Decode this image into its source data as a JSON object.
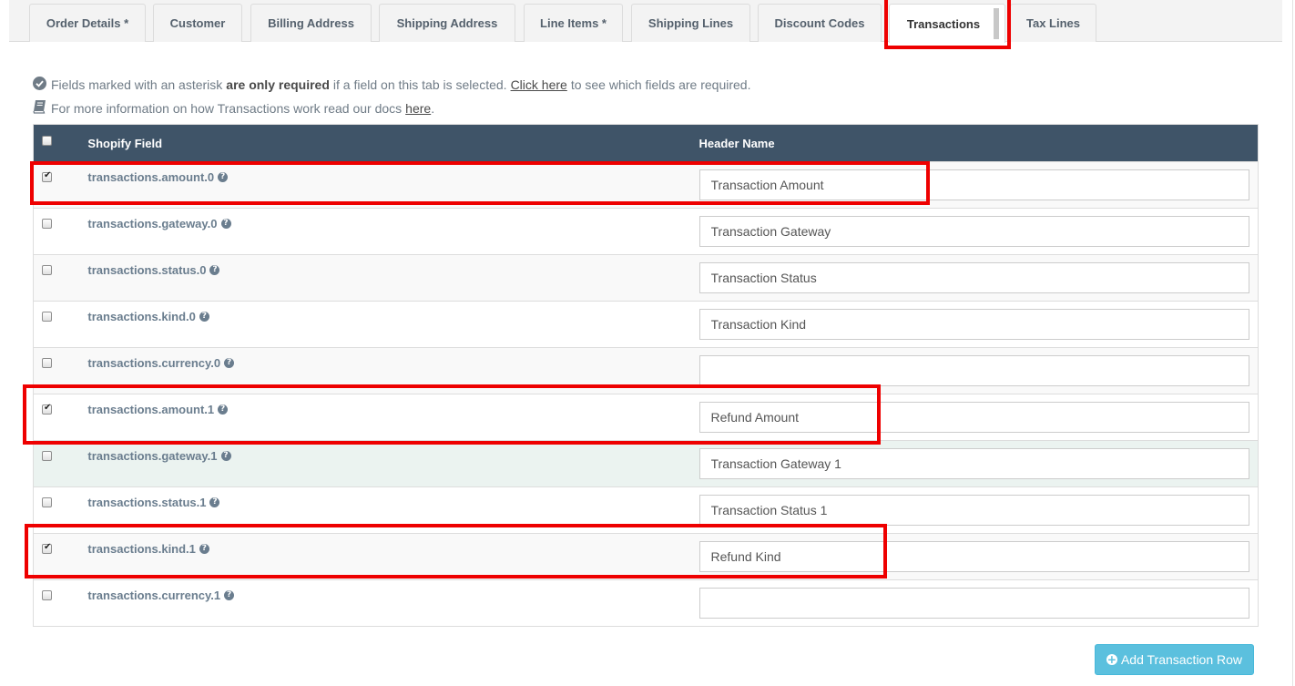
{
  "tabs": [
    {
      "label": "Order Details *"
    },
    {
      "label": "Customer"
    },
    {
      "label": "Billing Address"
    },
    {
      "label": "Shipping Address"
    },
    {
      "label": "Line Items *"
    },
    {
      "label": "Shipping Lines"
    },
    {
      "label": "Discount Codes"
    },
    {
      "label": "Transactions"
    },
    {
      "label": "Tax Lines"
    }
  ],
  "active_tab": "Transactions",
  "info": {
    "line1_pre": "Fields marked with an asterisk",
    "line1_bold": "are only required",
    "line1_mid": "if a field on this tab is selected.",
    "line1_link": "Click here",
    "line1_post": "to see which fields are required.",
    "line2_pre": "For more information on how Transactions work read our docs",
    "line2_link": "here",
    "line2_post": "."
  },
  "table": {
    "col_field": "Shopify Field",
    "col_header": "Header Name",
    "rows": [
      {
        "field": "transactions.amount.0",
        "header": "Transaction Amount",
        "checked": true
      },
      {
        "field": "transactions.gateway.0",
        "header": "Transaction Gateway",
        "checked": false
      },
      {
        "field": "transactions.status.0",
        "header": "Transaction Status",
        "checked": false
      },
      {
        "field": "transactions.kind.0",
        "header": "Transaction Kind",
        "checked": false
      },
      {
        "field": "transactions.currency.0",
        "header": "",
        "checked": false
      },
      {
        "field": "transactions.amount.1",
        "header": "Refund Amount",
        "checked": true
      },
      {
        "field": "transactions.gateway.1",
        "header": "Transaction Gateway 1",
        "checked": false
      },
      {
        "field": "transactions.status.1",
        "header": "Transaction Status 1",
        "checked": false
      },
      {
        "field": "transactions.kind.1",
        "header": "Refund Kind",
        "checked": true
      },
      {
        "field": "transactions.currency.1",
        "header": "",
        "checked": false
      }
    ]
  },
  "add_button": "Add Transaction Row",
  "colors": {
    "header_bg": "#3f5468",
    "button_bg": "#5bc0de",
    "highlight": "#ee0000"
  }
}
